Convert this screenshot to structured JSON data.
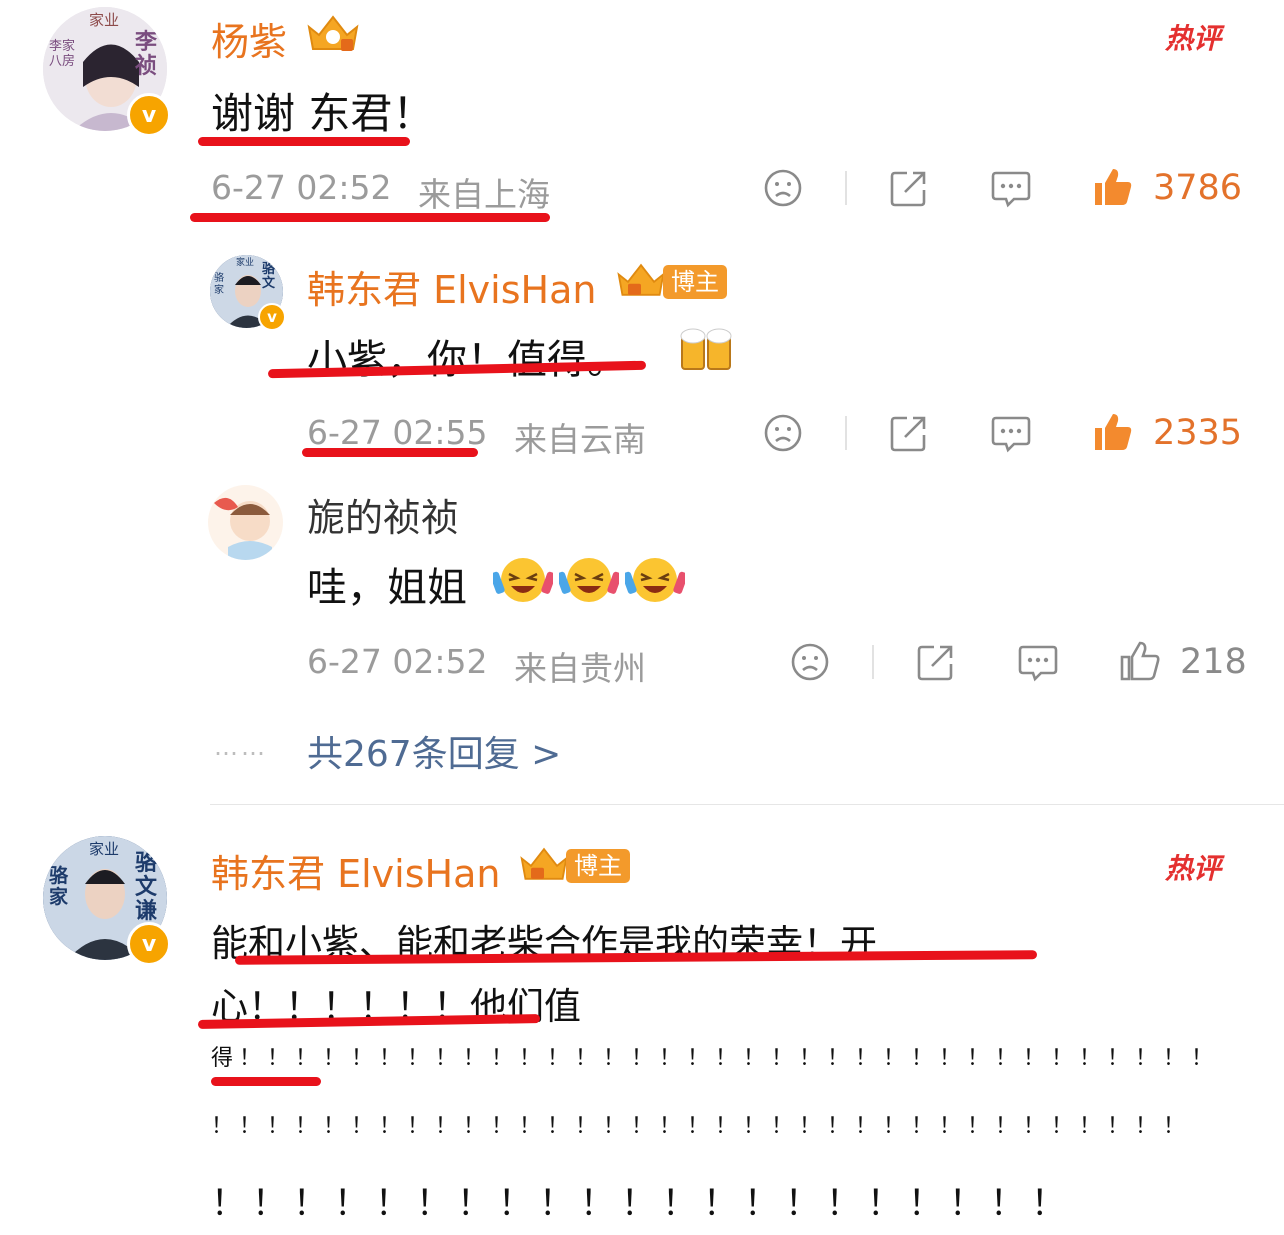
{
  "comments": [
    {
      "user": "杨紫",
      "hot_label": "热评",
      "text": "谢谢 东君！",
      "time": "6-27 02:52",
      "location": "来自上海",
      "likes": "3786",
      "avatar_text": [
        "家业",
        "李祯",
        "李家八房"
      ],
      "replies": [
        {
          "user": "韩东君 ElvisHan",
          "badge": "博主",
          "text": "小紫，你！值得。",
          "time": "6-27 02:55",
          "location": "来自云南",
          "likes": "2335",
          "avatar_text": [
            "家业",
            "骆文",
            "骆家"
          ]
        },
        {
          "user": "旎的祯祯",
          "text": "哇，姐姐",
          "time": "6-27 02:52",
          "location": "来自贵州",
          "likes": "218"
        }
      ],
      "more_replies": "共267条回复 >",
      "more_dots": "……"
    },
    {
      "user": "韩东君 ElvisHan",
      "badge": "博主",
      "hot_label": "热评",
      "text_lines": [
        "能和小紫、能和老柴合作是我的荣幸！开",
        "心！！！！！！他们值",
        "得！！！！！！！！！！！！！！！！！！！！！！！！！！！！！！！！！！！",
        "！！！！！！！！！！！！！！！！！！！！！！！！！！！！！！！！！！！",
        "！！！！！！！！！！！！！！！！！！！！！"
      ],
      "avatar_text": [
        "家业",
        "骆文谦",
        "骆家"
      ]
    }
  ],
  "colors": {
    "username": "#e8741f",
    "hot": "#e4302f",
    "underline": "#e8121b",
    "link": "#4f6b93",
    "meta": "#9b9b9b"
  },
  "icons": [
    "dislike-icon",
    "share-icon",
    "comment-icon",
    "like-icon",
    "crown-icon",
    "beer-emoji",
    "laugh-cry-emoji"
  ]
}
